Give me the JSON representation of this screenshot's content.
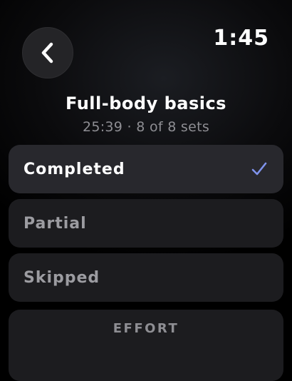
{
  "header": {
    "time": "1:45",
    "back_icon": "chevron-left-icon"
  },
  "workout": {
    "title": "Full-body basics",
    "subtitle": "25:39 · 8 of 8 sets"
  },
  "options": [
    {
      "label": "Completed",
      "selected": true,
      "icon": "checkmark-icon"
    },
    {
      "label": "Partial",
      "selected": false
    },
    {
      "label": "Skipped",
      "selected": false
    }
  ],
  "effort": {
    "label": "EFFORT"
  },
  "colors": {
    "accent": "#7f93ec",
    "selected_bg": "#28282d",
    "card_bg": "#1c1c1f",
    "secondary_text": "#8e8e93"
  }
}
